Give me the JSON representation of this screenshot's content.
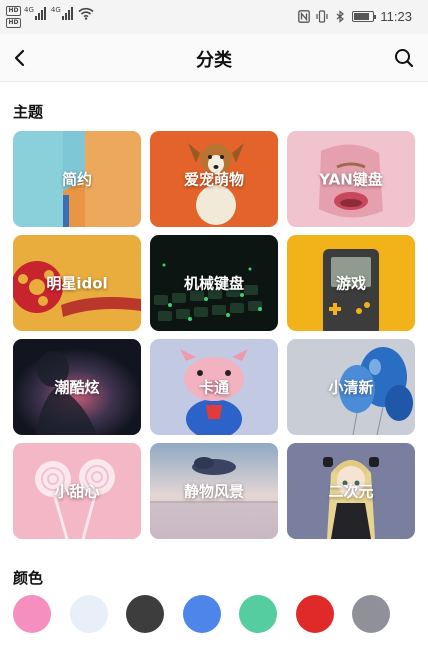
{
  "status_bar": {
    "time": "11:23",
    "sim_badges": [
      "HD",
      "HD"
    ],
    "network_labels": [
      "4G",
      "4G"
    ]
  },
  "header": {
    "title": "分类",
    "back_icon": "chevron-left-icon",
    "search_icon": "search-icon"
  },
  "themes_section": {
    "title": "主题",
    "tiles": [
      {
        "label": "简约"
      },
      {
        "label": "爱宠萌物"
      },
      {
        "label": "YAN键盘"
      },
      {
        "label": "明星idol"
      },
      {
        "label": "机械键盘"
      },
      {
        "label": "游戏"
      },
      {
        "label": "潮酷炫"
      },
      {
        "label": "卡通"
      },
      {
        "label": "小清新"
      },
      {
        "label": "小甜心"
      },
      {
        "label": "静物风景"
      },
      {
        "label": "二次元"
      }
    ]
  },
  "colors_section": {
    "title": "颜色",
    "swatches": [
      "#f58fbf",
      "#e8eff8",
      "#3d3d3d",
      "#4d86e8",
      "#55cda1",
      "#e02a2a",
      "#90909a"
    ]
  }
}
